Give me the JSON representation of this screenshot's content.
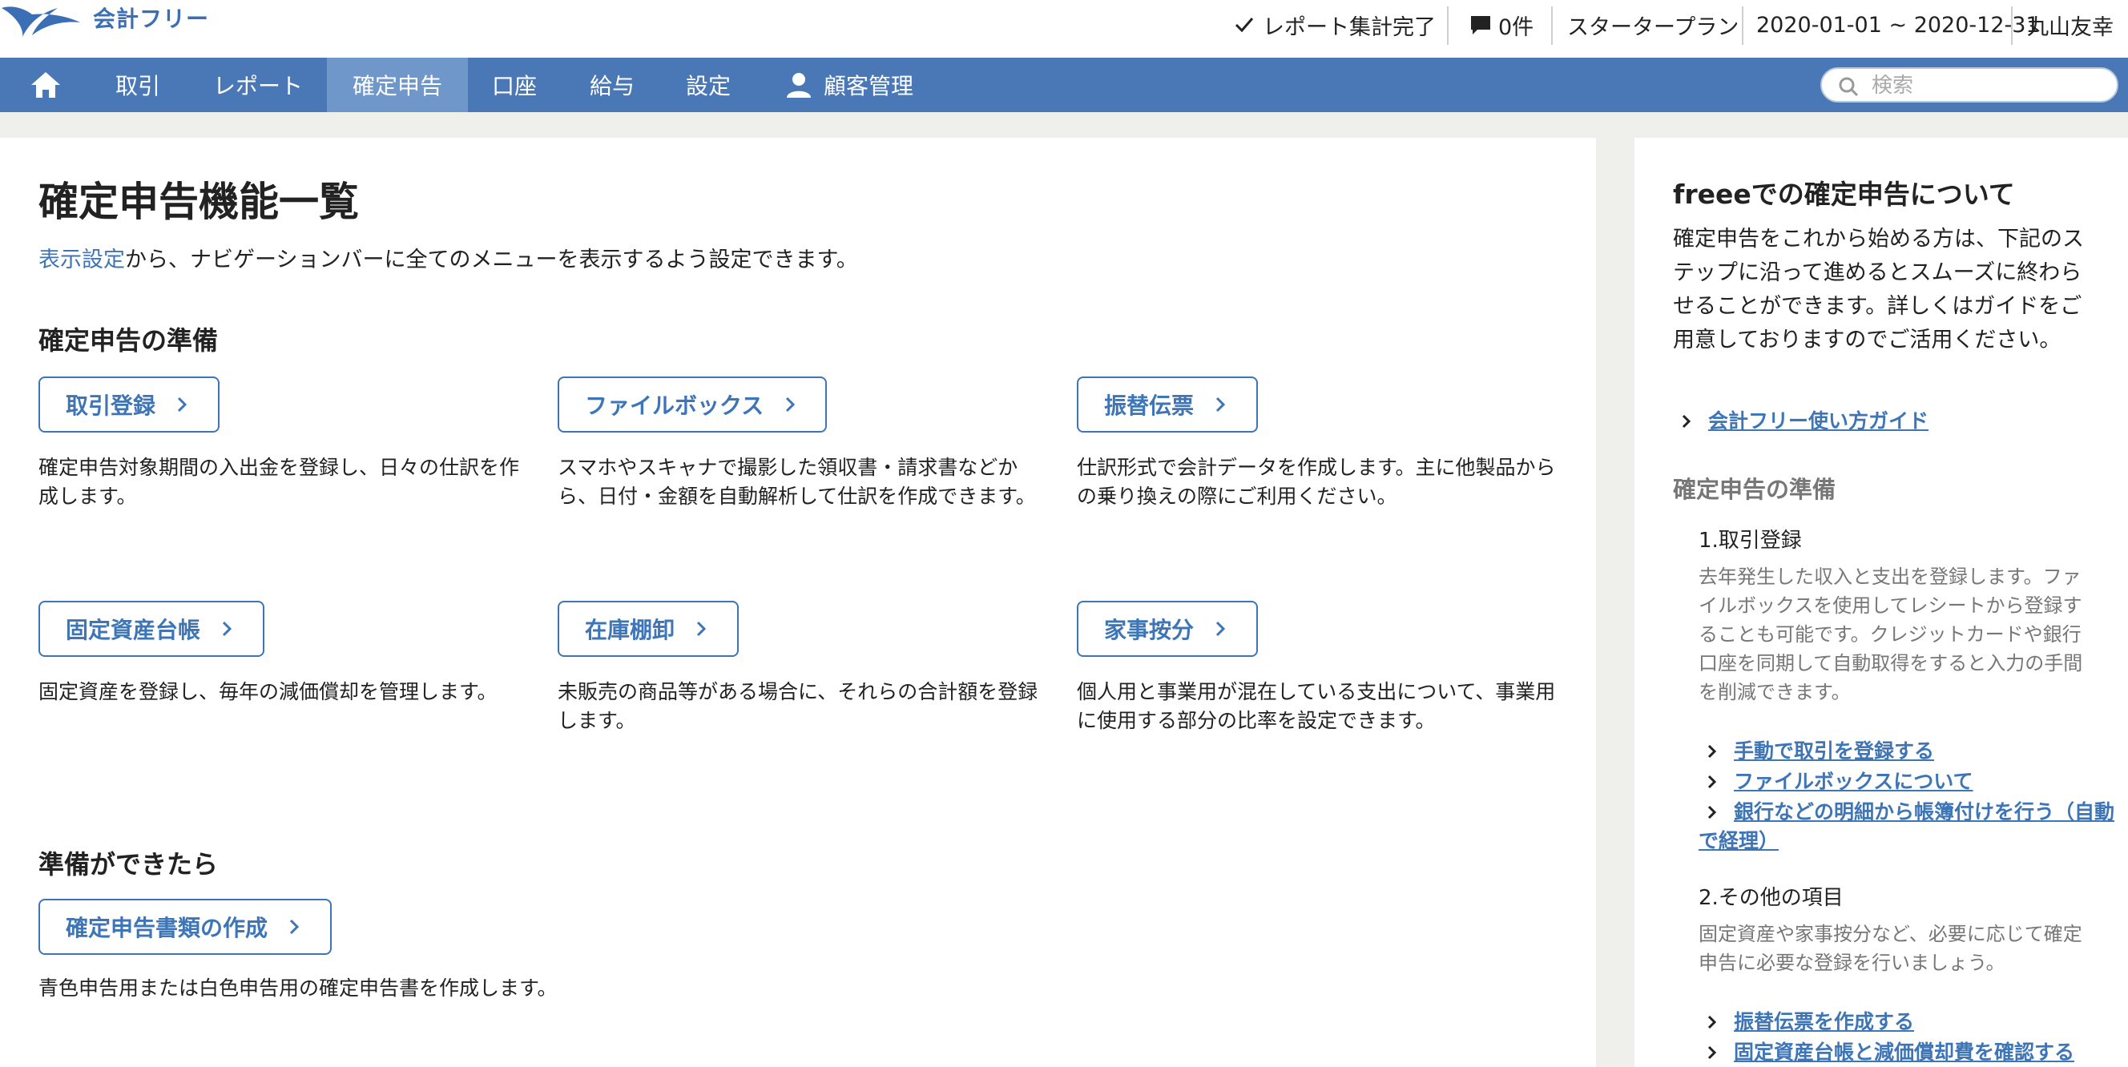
{
  "header": {
    "app_name": "会計フリー",
    "report_status": "レポート集計完了",
    "notification_count": "0件",
    "plan": "スタータープラン",
    "period": "2020-01-01 ~ 2020-12-31",
    "user_name": "丸山友幸"
  },
  "nav": {
    "items": [
      {
        "label": "取引"
      },
      {
        "label": "レポート"
      },
      {
        "label": "確定申告",
        "active": true
      },
      {
        "label": "口座"
      },
      {
        "label": "給与"
      },
      {
        "label": "設定"
      },
      {
        "label": "顧客管理"
      }
    ],
    "search_placeholder": "検索"
  },
  "main": {
    "title": "確定申告機能一覧",
    "intro_link": "表示設定",
    "intro_text": "から、ナビゲーションバーに全てのメニューを表示するよう設定できます。",
    "sections": [
      {
        "heading": "確定申告の準備",
        "features": [
          {
            "label": "取引登録",
            "desc": "確定申告対象期間の入出金を登録し、日々の仕訳を作成します。"
          },
          {
            "label": "ファイルボックス",
            "desc": "スマホやスキャナで撮影した領収書・請求書などから、日付・金額を自動解析して仕訳を作成できます。"
          },
          {
            "label": "振替伝票",
            "desc": "仕訳形式で会計データを作成します。主に他製品からの乗り換えの際にご利用ください。"
          },
          {
            "label": "固定資産台帳",
            "desc": "固定資産を登録し、毎年の減価償却を管理します。"
          },
          {
            "label": "在庫棚卸",
            "desc": "未販売の商品等がある場合に、それらの合計額を登録します。"
          },
          {
            "label": "家事按分",
            "desc": "個人用と事業用が混在している支出について、事業用に使用する部分の比率を設定できます。"
          }
        ]
      },
      {
        "heading": "準備ができたら",
        "features": [
          {
            "label": "確定申告書類の作成",
            "desc": "青色申告用または白色申告用の確定申告書を作成します。"
          }
        ]
      }
    ]
  },
  "side": {
    "title": "freeeでの確定申告について",
    "intro": "確定申告をこれから始める方は、下記のステップに沿って進めるとスムーズに終わらせることができます。詳しくはガイドをご用意しておりますのでご活用ください。",
    "guide_link": "会計フリー使い方ガイド",
    "section_heading": "確定申告の準備",
    "steps": [
      {
        "title": "1.取引登録",
        "desc": "去年発生した収入と支出を登録します。ファイルボックスを使用してレシートから登録することも可能です。クレジットカードや銀行口座を同期して自動取得をすると入力の手間を削減できます。",
        "links": [
          "手動で取引を登録する",
          "ファイルボックスについて",
          "銀行などの明細から帳簿付けを行う（自動で経理）"
        ]
      },
      {
        "title": "2.その他の項目",
        "desc": "固定資産や家事按分など、必要に応じて確定申告に必要な登録を行いましょう。",
        "links": [
          "振替伝票を作成する",
          "固定資産台帳と減価償却費を確認する"
        ]
      }
    ]
  },
  "colors": {
    "nav_bg": "#4a78b6",
    "nav_active": "#6f97c9",
    "link": "#3e75b6",
    "page_bg": "#efefec"
  },
  "icons": [
    "logo-bird-icon",
    "check-icon",
    "comment-icon",
    "home-icon",
    "person-icon",
    "search-icon",
    "chevron-right-icon"
  ]
}
